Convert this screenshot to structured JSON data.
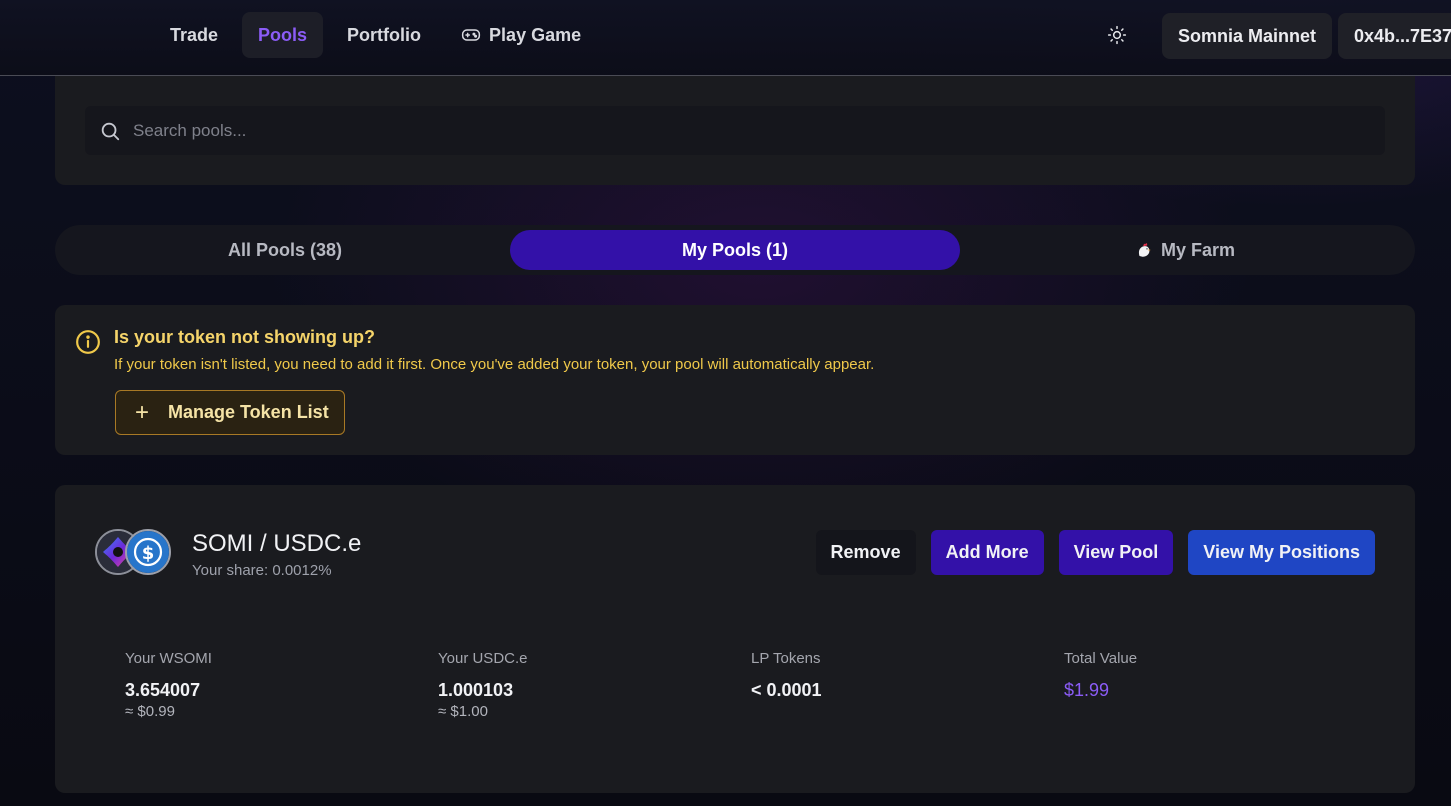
{
  "header": {
    "nav": [
      {
        "label": "Trade",
        "active": false
      },
      {
        "label": "Pools",
        "active": true
      },
      {
        "label": "Portfolio",
        "active": false
      },
      {
        "label": "Play Game",
        "active": false,
        "icon": "gamepad-icon"
      }
    ],
    "theme_icon": "sun-icon",
    "network": "Somnia Mainnet",
    "wallet": "0x4b...7E37"
  },
  "search": {
    "placeholder": "Search pools...",
    "icon": "search-icon"
  },
  "tabs": [
    {
      "label": "All Pools (38)",
      "active": false
    },
    {
      "label": "My Pools (1)",
      "active": true
    },
    {
      "label": "My Farm",
      "active": false,
      "icon": "chicken-icon"
    }
  ],
  "notice": {
    "title": "Is your token not showing up?",
    "text": "If your token isn't listed, you need to add it first. Once you've added your token, your pool will automatically appear.",
    "button": "Manage Token List",
    "icon": "info-icon",
    "accent": "#f0c94a"
  },
  "pool": {
    "pair": "SOMI / USDC.e",
    "share": "Your share: 0.0012%",
    "actions": {
      "remove": "Remove",
      "add_more": "Add More",
      "view_pool": "View Pool",
      "view_positions": "View My Positions"
    },
    "stats": [
      {
        "label": "Your WSOMI",
        "value": "3.654007",
        "sub": "≈ $0.99"
      },
      {
        "label": "Your USDC.e",
        "value": "1.000103",
        "sub": "≈ $1.00"
      },
      {
        "label": "LP Tokens",
        "value": "< 0.0001",
        "sub": ""
      },
      {
        "label": "Total Value",
        "value": "$1.99",
        "sub": ""
      }
    ]
  },
  "colors": {
    "accent_purple": "#8b5cf6",
    "tab_active": "#3311a8",
    "positions_blue": "#1f46c4"
  }
}
